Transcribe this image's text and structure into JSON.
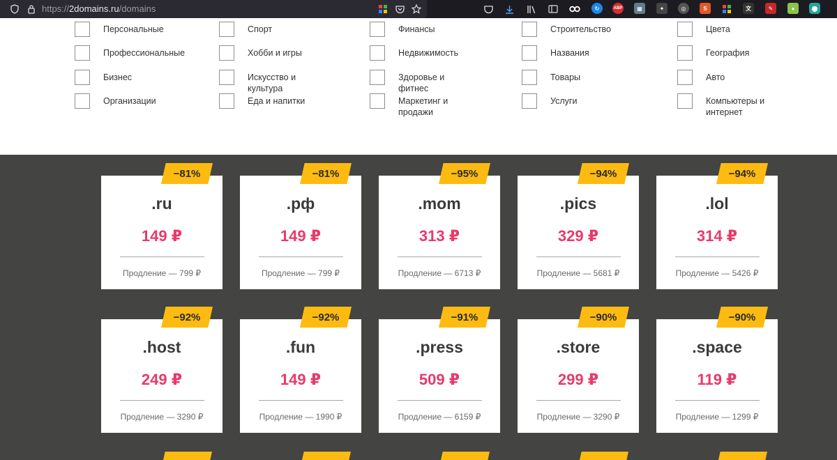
{
  "browser": {
    "url_scheme": "https://",
    "url_host": "2domains.ru",
    "url_path": "/domains"
  },
  "categories": [
    [
      "Персональные",
      "Спорт",
      "Финансы",
      "Строительство",
      "Цвета"
    ],
    [
      "Профессиональные",
      "Хобби и игры",
      "Недвижимость",
      "Названия",
      "География"
    ],
    [
      "Бизнес",
      "Искусство и культура",
      "Здоровье и фитнес",
      "Товары",
      "Авто"
    ],
    [
      "Организации",
      "Еда и напитки",
      "Маркетинг и продажи",
      "Услуги",
      "Компьютеры и интернет"
    ]
  ],
  "domains": [
    {
      "discount": "−81%",
      "zone": ".ru",
      "price": "149 ₽",
      "renewal": "Продление — 799 ₽"
    },
    {
      "discount": "−81%",
      "zone": ".рф",
      "price": "149 ₽",
      "renewal": "Продление — 799 ₽"
    },
    {
      "discount": "−95%",
      "zone": ".mom",
      "price": "313 ₽",
      "renewal": "Продление — 6713 ₽"
    },
    {
      "discount": "−94%",
      "zone": ".pics",
      "price": "329 ₽",
      "renewal": "Продление — 5681 ₽"
    },
    {
      "discount": "−94%",
      "zone": ".lol",
      "price": "314 ₽",
      "renewal": "Продление — 5426 ₽"
    },
    {
      "discount": "−92%",
      "zone": ".host",
      "price": "249 ₽",
      "renewal": "Продление — 3290 ₽"
    },
    {
      "discount": "−92%",
      "zone": ".fun",
      "price": "149 ₽",
      "renewal": "Продление — 1990 ₽"
    },
    {
      "discount": "−91%",
      "zone": ".press",
      "price": "509 ₽",
      "renewal": "Продление — 6159 ₽"
    },
    {
      "discount": "−90%",
      "zone": ".store",
      "price": "299 ₽",
      "renewal": "Продление — 3290 ₽"
    },
    {
      "discount": "−90%",
      "zone": ".space",
      "price": "119 ₽",
      "renewal": "Продление — 1299 ₽"
    }
  ],
  "colors": {
    "badge": "#fdbb12",
    "price": "#e83a6c",
    "section_bg": "#444442"
  }
}
